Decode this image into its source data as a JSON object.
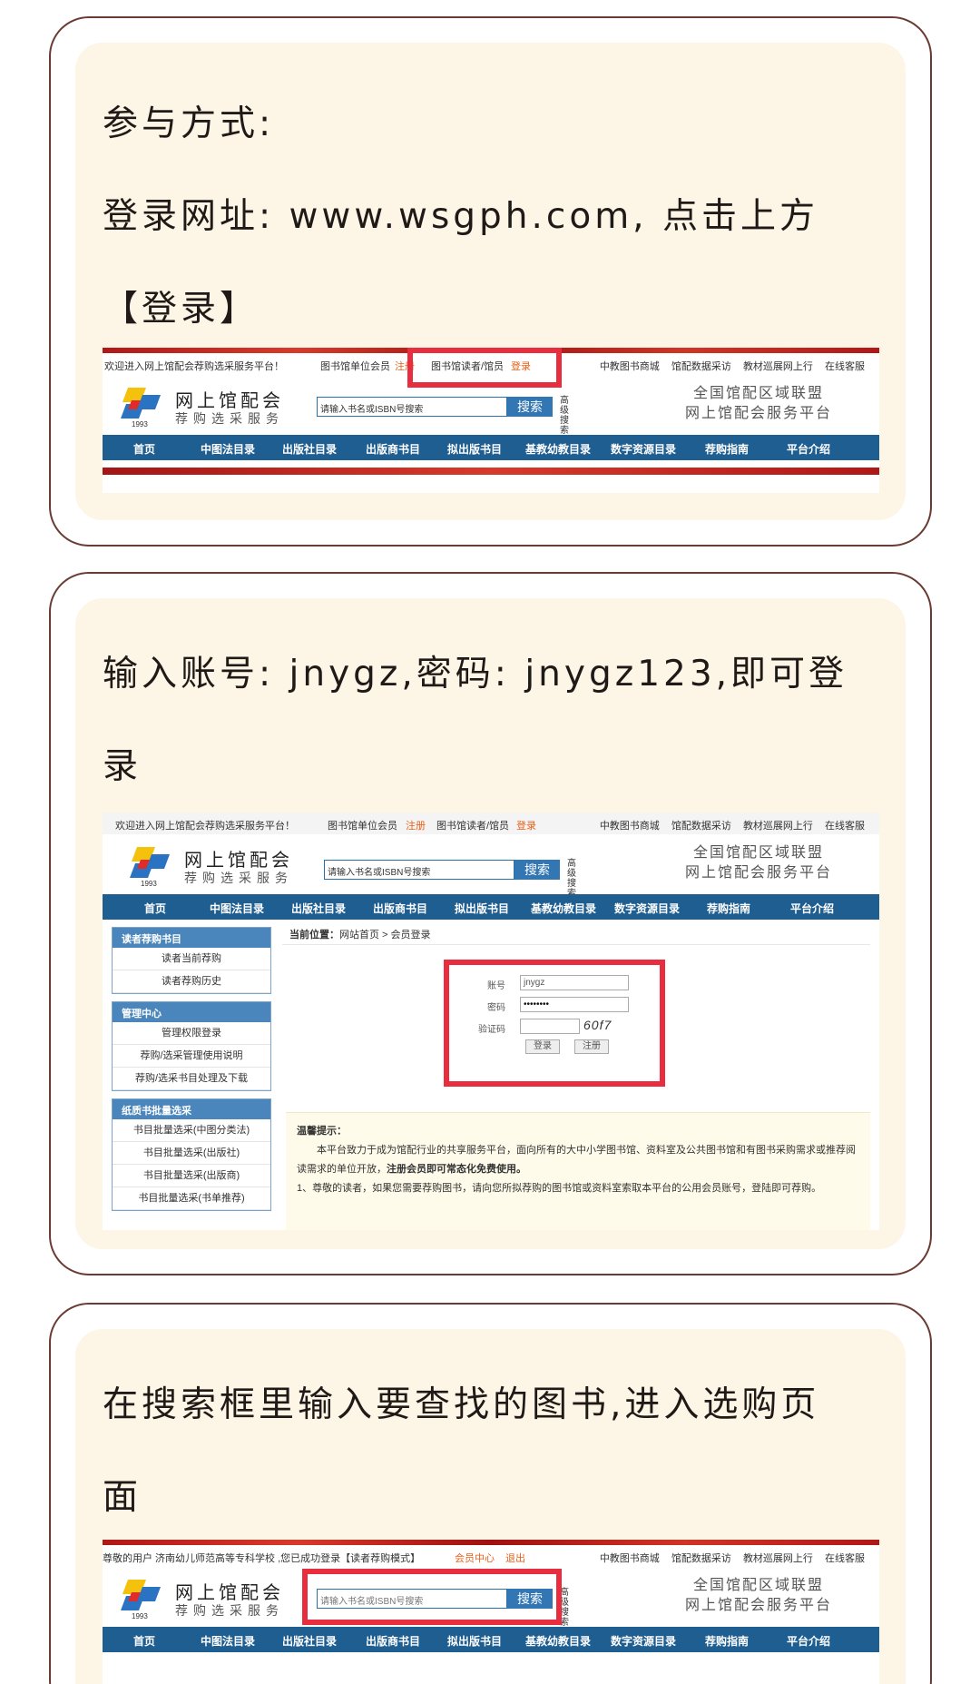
{
  "step1": {
    "line1": "参与方式:",
    "line2": "登录网址: www.wsgph.com, 点击上方",
    "line3": "【登录】"
  },
  "step2": {
    "line1": "输入账号: jnygz,密码: jnygz123,即可登",
    "line2": "录"
  },
  "step3": {
    "line1": "在搜索框里输入要查找的图书,进入选购页",
    "line2": "面"
  },
  "site": {
    "welcome": "欢迎进入网上馆配会荐购选采服务平台！",
    "member_unit": "图书馆单位会员",
    "register": "注册",
    "reader_staff": "图书馆读者/馆员",
    "login": "登录",
    "top_links": [
      "中教图书商城",
      "馆配数据采访",
      "教材巡展网上行",
      "在线客服"
    ],
    "logo_year": "1993",
    "brand_title": "网上馆配会",
    "brand_sub": "荐购选采服务",
    "search_placeholder": "请输入书名或ISBN号搜索",
    "search_button": "搜索",
    "advanced_search": "高级搜索",
    "alliance_line1": "全国馆配区域联盟",
    "alliance_line2": "网上馆配会服务平台",
    "nav": [
      "首页",
      "中图法目录",
      "出版社目录",
      "出版商书目",
      "拟出版书目",
      "基教幼教目录",
      "数字资源目录",
      "荐购指南",
      "平台介绍"
    ],
    "logged_in_greeting": "尊敬的用户 济南幼儿师范高等专科学校 ,您已成功登录【读者荐购模式】",
    "member_center": "会员中心",
    "logout": "退出"
  },
  "login_page": {
    "sidebar": [
      {
        "head": "读者荐购书目",
        "items": [
          "读者当前荐购",
          "读者荐购历史"
        ]
      },
      {
        "head": "管理中心",
        "items": [
          "管理权限登录",
          "荐购/选采管理使用说明",
          "荐购/选采书目处理及下载"
        ]
      },
      {
        "head": "纸质书批量选采",
        "items": [
          "书目批量选采(中图分类法)",
          "书目批量选采(出版社)",
          "书目批量选采(出版商)",
          "书目批量选采(书单推荐)"
        ]
      }
    ],
    "crumb_label": "当前位置：",
    "crumb_path": "网站首页 > 会员登录",
    "account_label": "账号",
    "account_value": "jnygz",
    "password_label": "密码",
    "password_value": "••••••••",
    "captcha_label": "验证码",
    "captcha_value": "60f7",
    "login_button": "登录",
    "register_button": "注册",
    "tips_title": "温馨提示：",
    "tips_p1": "本平台致力于成为馆配行业的共享服务平台，面向所有的大中小学图书馆、资料室及公共图书馆和有图书采购需求或推荐阅读需求的单位开放，",
    "tips_p1_bold": "注册会员即可常态化免费使用。",
    "tips_p2": "1、尊敬的读者，如果您需要荐购图书，请向您所拟荐购的图书馆或资料室索取本平台的公用会员账号，登陆即可荐购。"
  }
}
